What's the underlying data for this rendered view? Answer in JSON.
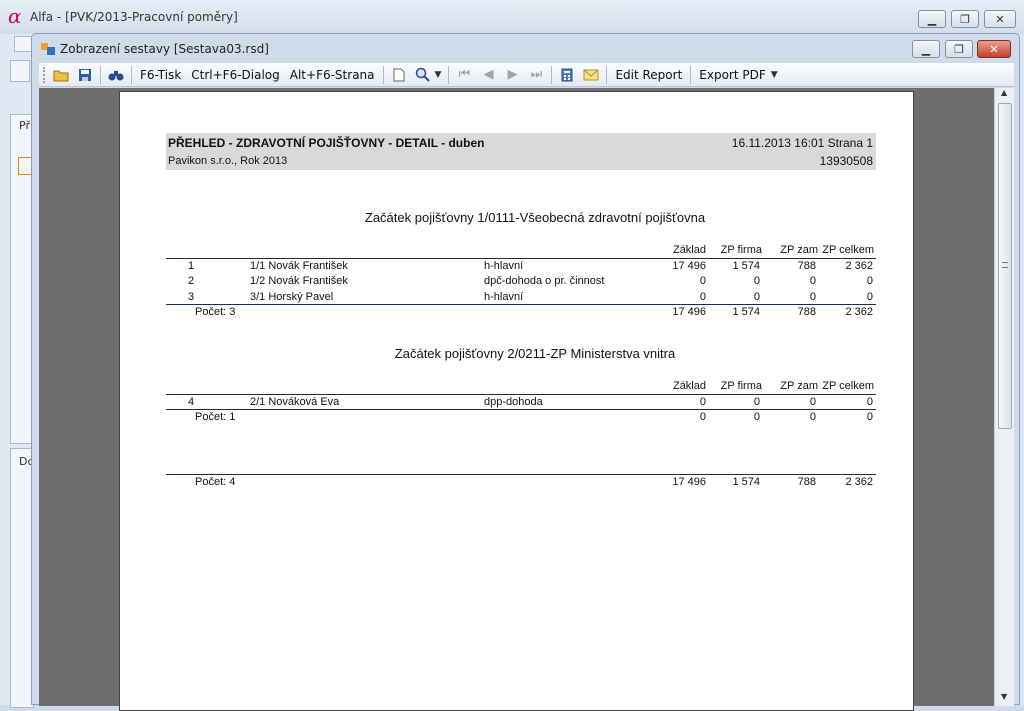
{
  "outer": {
    "logo": "α",
    "title": "Alfa - [PVK/2013-Pracovní poměry]",
    "bg_labels": [
      "Př",
      "Dc"
    ]
  },
  "inner": {
    "title": "Zobrazení sestavy [Sestava03.rsd]"
  },
  "toolbar": {
    "print": "F6-Tisk",
    "dialog": "Ctrl+F6-Dialog",
    "page": "Alt+F6-Strana",
    "edit": "Edit Report",
    "export": "Export PDF"
  },
  "report": {
    "title": "PŘEHLED - ZDRAVOTNÍ POJIŠŤOVNY - DETAIL  - duben",
    "datetime": "16.11.2013 16:01  Strana 1",
    "company": "Pavikon s.r.o., Rok 2013",
    "code": "13930508",
    "columns": [
      "Základ",
      "ZP firma",
      "ZP zam",
      "ZP celkem"
    ],
    "groups": [
      {
        "heading": "Začátek pojišťovny 1/0111-Všeobecná zdravotní pojišťovna",
        "rows": [
          {
            "no": "1",
            "name": "1/1 Novák František",
            "type": "h-hlavní",
            "zaklad": "17 496",
            "firma": "1 574",
            "zam": "788",
            "celkem": "2 362"
          },
          {
            "no": "2",
            "name": "1/2 Novák František",
            "type": "dpč-dohoda o pr. činnost",
            "zaklad": "0",
            "firma": "0",
            "zam": "0",
            "celkem": "0"
          },
          {
            "no": "3",
            "name": "3/1 Horský Pavel",
            "type": "h-hlavní",
            "zaklad": "0",
            "firma": "0",
            "zam": "0",
            "celkem": "0"
          }
        ],
        "total": {
          "label": "Počet: 3",
          "zaklad": "17 496",
          "firma": "1 574",
          "zam": "788",
          "celkem": "2 362"
        }
      },
      {
        "heading": "Začátek pojišťovny 2/0211-ZP Ministerstva vnitra",
        "rows": [
          {
            "no": "4",
            "name": "2/1 Nováková Eva",
            "type": "dpp-dohoda",
            "zaklad": "0",
            "firma": "0",
            "zam": "0",
            "celkem": "0"
          }
        ],
        "total": {
          "label": "Počet: 1",
          "zaklad": "0",
          "firma": "0",
          "zam": "0",
          "celkem": "0"
        }
      }
    ],
    "grand_total": {
      "label": "Počet: 4",
      "zaklad": "17 496",
      "firma": "1 574",
      "zam": "788",
      "celkem": "2 362"
    }
  }
}
